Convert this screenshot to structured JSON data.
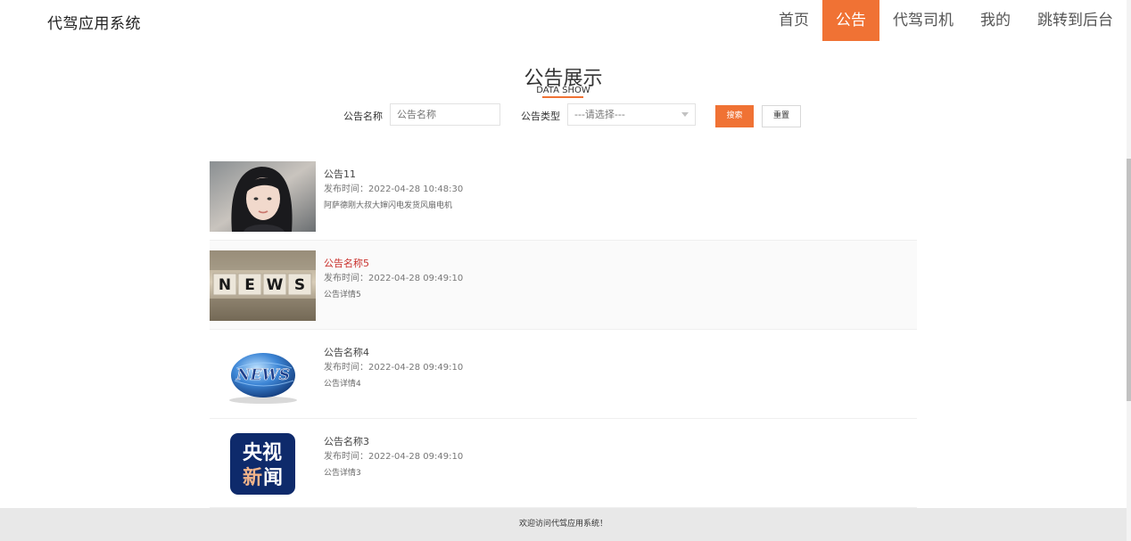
{
  "header": {
    "brand": "代驾应用系统",
    "nav": [
      "首页",
      "公告",
      "代驾司机",
      "我的",
      "跳转到后台"
    ],
    "active_nav": "公告"
  },
  "page": {
    "title": "公告展示",
    "subtitle": "DATA SHOW"
  },
  "search": {
    "name_label": "公告名称",
    "name_placeholder": "公告名称",
    "type_label": "公告类型",
    "type_selected": "---请选择---",
    "search_button": "搜索",
    "reset_button": "重置"
  },
  "notices": [
    {
      "title": "公告11",
      "time": "发布时间：2022-04-28 10:48:30",
      "desc": "阿萨德刚大叔大婶闪电发货风扇电机"
    },
    {
      "title": "公告名称5",
      "time": "发布时间：2022-04-28 09:49:10",
      "desc": "公告详情5"
    },
    {
      "title": "公告名称4",
      "time": "发布时间：2022-04-28 09:49:10",
      "desc": "公告详情4"
    },
    {
      "title": "公告名称3",
      "time": "发布时间：2022-04-28 09:49:10",
      "desc": "公告详情3"
    }
  ],
  "thumbs": {
    "news_blocks": [
      "N",
      "E",
      "W",
      "S"
    ],
    "globe_text": "NEWS",
    "cctv_line1": "央视",
    "cctv_line2_a": "新",
    "cctv_line2_b": "闻"
  },
  "footer": {
    "text": "欢迎访问代驾应用系统！"
  },
  "colors": {
    "accent": "#f07234",
    "hover_title": "#c9302c",
    "footer_bg": "#e8e8e8"
  }
}
